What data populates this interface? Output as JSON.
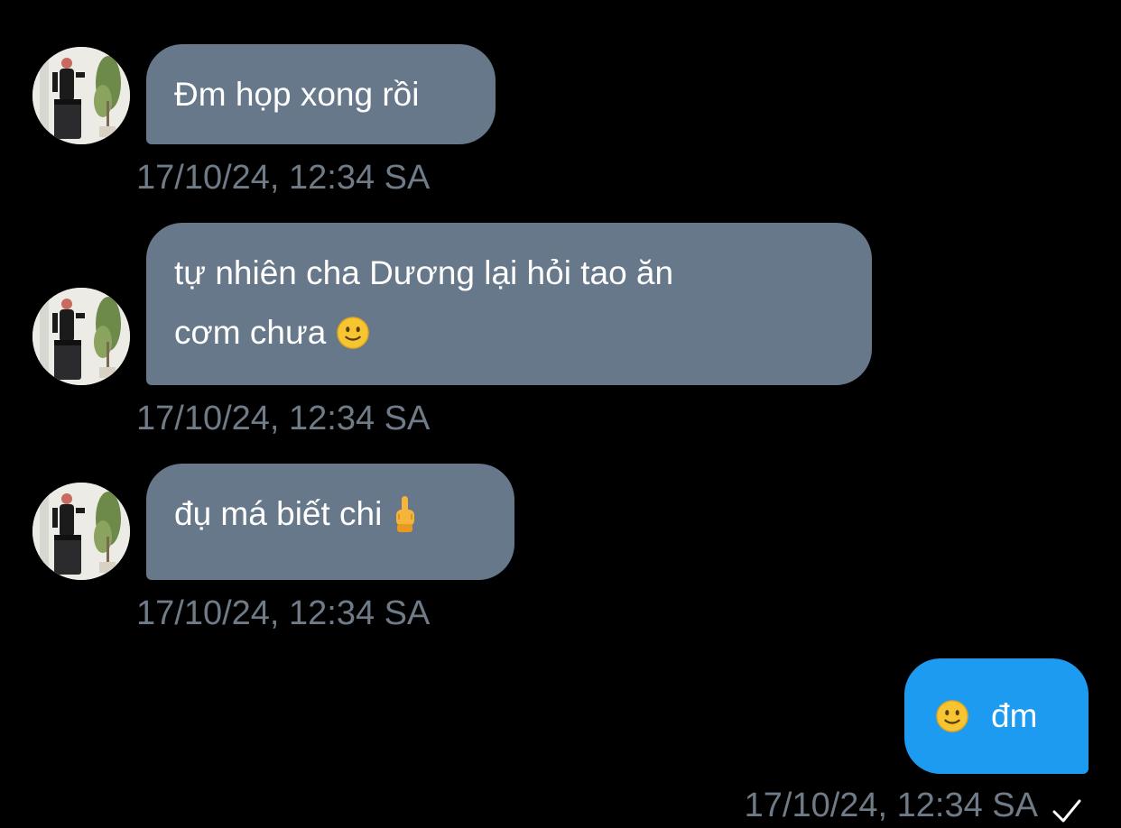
{
  "conversation": {
    "incoming": [
      {
        "lines": [
          "Đm họp xong rồi"
        ],
        "timestamp": "17/10/24, 12:34 SA"
      },
      {
        "lines": [
          "tự nhiên cha Dương lại hỏi tao ăn",
          "cơm chưa"
        ],
        "emoji": "slightly-smiling-face-icon",
        "timestamp": "17/10/24, 12:34 SA"
      },
      {
        "lines": [
          "đụ má biết chi"
        ],
        "emoji": "middle-finger-icon",
        "timestamp": "17/10/24, 12:34 SA"
      }
    ],
    "outgoing": [
      {
        "emoji": "slightly-smiling-face-icon",
        "text": "đm",
        "timestamp": "17/10/24, 12:34 SA",
        "status_icon": "checkmark-icon"
      }
    ]
  },
  "colors": {
    "background": "#000000",
    "incoming_bubble": "#66788a",
    "outgoing_bubble": "#1d9bf0",
    "timestamp": "#6f7b87",
    "text": "#ffffff"
  }
}
